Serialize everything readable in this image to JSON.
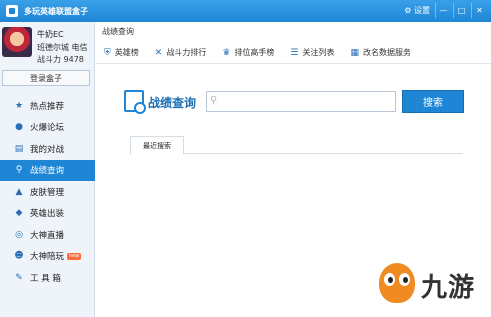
{
  "app": {
    "title": "多玩英雄联盟盒子"
  },
  "window_controls": {
    "settings": "设置",
    "minimize": "—",
    "maximize": "□",
    "close": "✕"
  },
  "profile": {
    "name": "牛奶EC",
    "server": "班德尔城 电信",
    "power": "战斗力 9478",
    "login_box": "登录盒子"
  },
  "sidebar": {
    "items": [
      {
        "label": "热点推荐",
        "icon": "star-icon"
      },
      {
        "label": "火爆论坛",
        "icon": "chat-icon"
      },
      {
        "label": "我的对战",
        "icon": "book-icon"
      },
      {
        "label": "战绩查询",
        "icon": "search-icon",
        "active": true
      },
      {
        "label": "皮肤管理",
        "icon": "hat-icon"
      },
      {
        "label": "英雄出装",
        "icon": "cube-icon"
      },
      {
        "label": "大神直播",
        "icon": "target-icon"
      },
      {
        "label": "大神陪玩",
        "icon": "people-icon",
        "badge": "new"
      },
      {
        "label": "工 具 箱",
        "icon": "tools-icon"
      }
    ]
  },
  "main": {
    "breadcrumb": "战绩查询",
    "toolbar": [
      {
        "label": "英雄榜",
        "icon": "shield-icon"
      },
      {
        "label": "战斗力排行",
        "icon": "swords-icon"
      },
      {
        "label": "排位高手榜",
        "icon": "trophy-icon"
      },
      {
        "label": "关注列表",
        "icon": "list-icon"
      },
      {
        "label": "改名数据服务",
        "icon": "data-icon"
      }
    ],
    "search": {
      "title": "战绩查询",
      "value": "",
      "button": "搜索"
    },
    "tabs": [
      {
        "label": "最近搜索"
      }
    ]
  },
  "watermark": {
    "text": "九游"
  },
  "colors": {
    "accent": "#1f86d6",
    "sidebar_bg": "#eef4fa",
    "badge": "#ff6a3d",
    "watermark_orange": "#f08a22"
  }
}
